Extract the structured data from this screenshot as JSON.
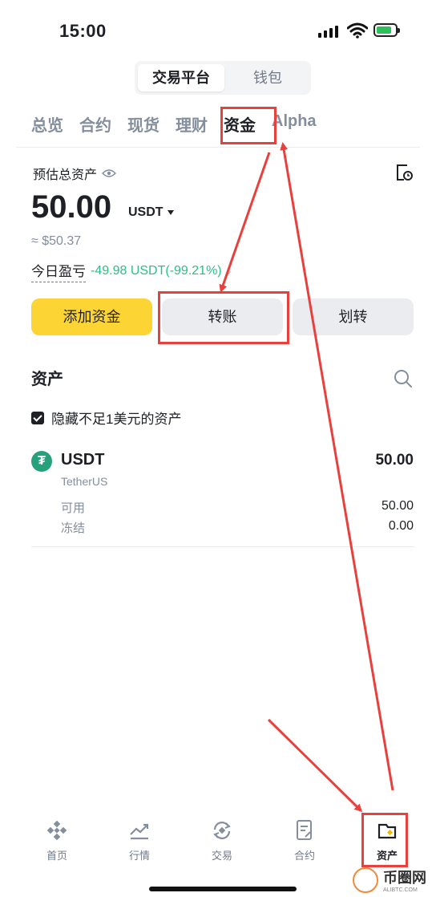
{
  "status_bar": {
    "time": "15:00"
  },
  "segment": {
    "active": "交易平台",
    "inactive": "钱包"
  },
  "tabs": [
    "总览",
    "合约",
    "现货",
    "理财",
    "资金",
    "Alpha"
  ],
  "active_tab": "资金",
  "overview": {
    "est_label": "预估总资产",
    "balance": "50.00",
    "unit": "USDT",
    "approx": "≈ $50.37",
    "pnl_label": "今日盈亏",
    "pnl_value": "-49.98 USDT(-99.21%)"
  },
  "actions": {
    "add": "添加资金",
    "transfer": "转账",
    "move": "划转"
  },
  "assets": {
    "title": "资产",
    "hide_small": "隐藏不足1美元的资产",
    "items": [
      {
        "symbol": "USDT",
        "name": "TetherUS",
        "total": "50.00",
        "available_label": "可用",
        "available": "50.00",
        "frozen_label": "冻结",
        "frozen": "0.00"
      }
    ]
  },
  "nav": [
    "首页",
    "行情",
    "交易",
    "合约",
    "资产"
  ],
  "active_nav": "资产",
  "watermark": {
    "title": "币圈网",
    "sub": "ALIBTC.COM"
  },
  "colors": {
    "accent": "#fcd535",
    "positive": "#2ebd85",
    "annotation": "#e8413d",
    "usdt": "#26a17b"
  },
  "icons": [
    "eye-icon",
    "history-icon",
    "caret-down-icon",
    "chevron-right-icon",
    "search-icon",
    "checkbox-icon",
    "usdt-icon",
    "home-icon",
    "markets-icon",
    "trade-icon",
    "futures-icon",
    "wallet-icon"
  ]
}
